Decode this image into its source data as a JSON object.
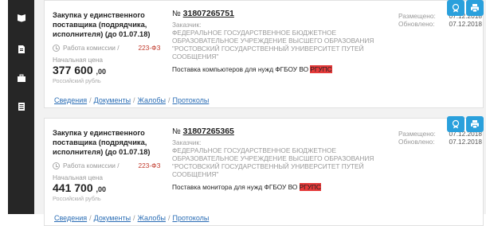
{
  "sidebar": {
    "items": [
      {
        "icon": "book-icon"
      },
      {
        "icon": "document-icon"
      },
      {
        "icon": "briefcase-icon"
      },
      {
        "icon": "list-icon"
      }
    ]
  },
  "cards": [
    {
      "procurement_type": "Закупка у единственного поставщика (подрядчика, исполнителя) (до 01.07.18)",
      "status": "Работа комиссии /",
      "law": "223-ФЗ",
      "price_label": "Начальная цена",
      "price_main": "377 600",
      "price_cents": ",00",
      "currency": "Российский рубль",
      "number_prefix": "№",
      "number": "31807265751",
      "customer_label": "Заказчик:",
      "customer_name": "ФЕДЕРАЛЬНОЕ ГОСУДАРСТВЕННОЕ БЮДЖЕТНОЕ ОБРАЗОВАТЕЛЬНОЕ УЧРЕЖДЕНИЕ ВЫСШЕГО ОБРАЗОВАНИЯ \"РОСТОВСКИЙ ГОСУДАРСТВЕННЫЙ УНИВЕРСИТЕТ ПУТЕЙ СООБЩЕНИЯ\"",
      "subject_prefix": "Поставка компьютеров для нужд ФГБОУ ВО",
      "subject_highlight": "РГУПС",
      "placed_label": "Размещено:",
      "placed_date": "07.12.2018",
      "updated_label": "Обновлено:",
      "updated_date": "07.12.2018"
    },
    {
      "procurement_type": "Закупка у единственного поставщика (подрядчика, исполнителя) (до 01.07.18)",
      "status": "Работа комиссии /",
      "law": "223-ФЗ",
      "price_label": "Начальная цена",
      "price_main": "441 700",
      "price_cents": ",00",
      "currency": "Российский рубль",
      "number_prefix": "№",
      "number": "31807265365",
      "customer_label": "Заказчик:",
      "customer_name": "ФЕДЕРАЛЬНОЕ ГОСУДАРСТВЕННОЕ БЮДЖЕТНОЕ ОБРАЗОВАТЕЛЬНОЕ УЧРЕЖДЕНИЕ ВЫСШЕГО ОБРАЗОВАНИЯ \"РОСТОВСКИЙ ГОСУДАРСТВЕННЫЙ УНИВЕРСИТЕТ ПУТЕЙ СООБЩЕНИЯ\"",
      "subject_prefix": "Поставка монитора для нужд ФГБОУ ВО",
      "subject_highlight": "РГУПС",
      "placed_label": "Размещено:",
      "placed_date": "07.12.2018",
      "updated_label": "Обновлено:",
      "updated_date": "07.12.2018"
    }
  ],
  "links": [
    "Сведения",
    "Документы",
    "Жалобы",
    "Протоколы"
  ],
  "colors": {
    "accent": "#2aa0dc",
    "highlight": "#e53a3a",
    "sidebar": "#262626",
    "link": "#2a6db5",
    "law": "#c0392b"
  }
}
